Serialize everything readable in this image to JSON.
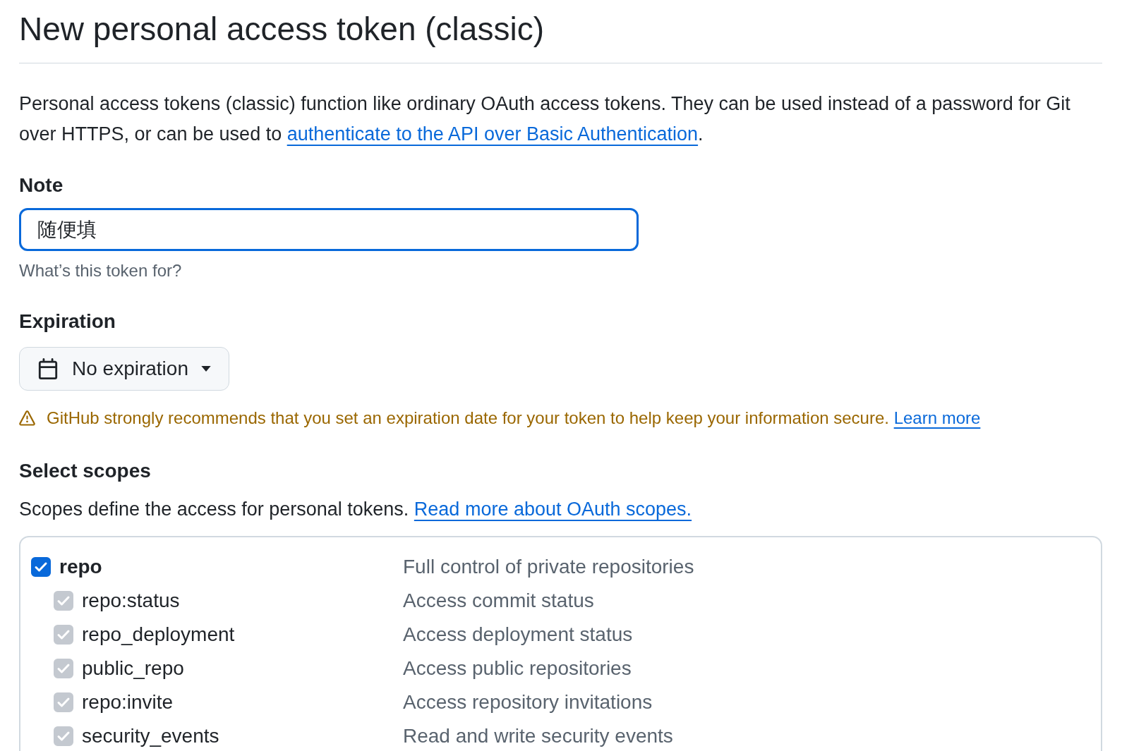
{
  "page": {
    "title": "New personal access token (classic)"
  },
  "intro": {
    "text": "Personal access tokens (classic) function like ordinary OAuth access tokens. They can be used instead of a password for Git over HTTPS, or can be used to ",
    "link": "authenticate to the API over Basic Authentication",
    "end": "."
  },
  "note": {
    "label": "Note",
    "value": "随便填",
    "focused": true,
    "hint": "What’s this token for?"
  },
  "expiration": {
    "label": "Expiration",
    "value": "No expiration",
    "warning": "GitHub strongly recommends that you set an expiration date for your token to help keep your information secure.",
    "warning_link": "Learn more"
  },
  "scopes": {
    "heading": "Select scopes",
    "description": "Scopes define the access for personal tokens.",
    "link": "Read more about OAuth scopes.",
    "items": [
      {
        "name": "repo",
        "description": "Full control of private repositories",
        "checked": true,
        "disabled": false,
        "children": [
          {
            "name": "repo:status",
            "description": "Access commit status",
            "checked": true,
            "disabled": true
          },
          {
            "name": "repo_deployment",
            "description": "Access deployment status",
            "checked": true,
            "disabled": true
          },
          {
            "name": "public_repo",
            "description": "Access public repositories",
            "checked": true,
            "disabled": true
          },
          {
            "name": "repo:invite",
            "description": "Access repository invitations",
            "checked": true,
            "disabled": true
          },
          {
            "name": "security_events",
            "description": "Read and write security events",
            "checked": true,
            "disabled": true
          }
        ]
      }
    ]
  }
}
